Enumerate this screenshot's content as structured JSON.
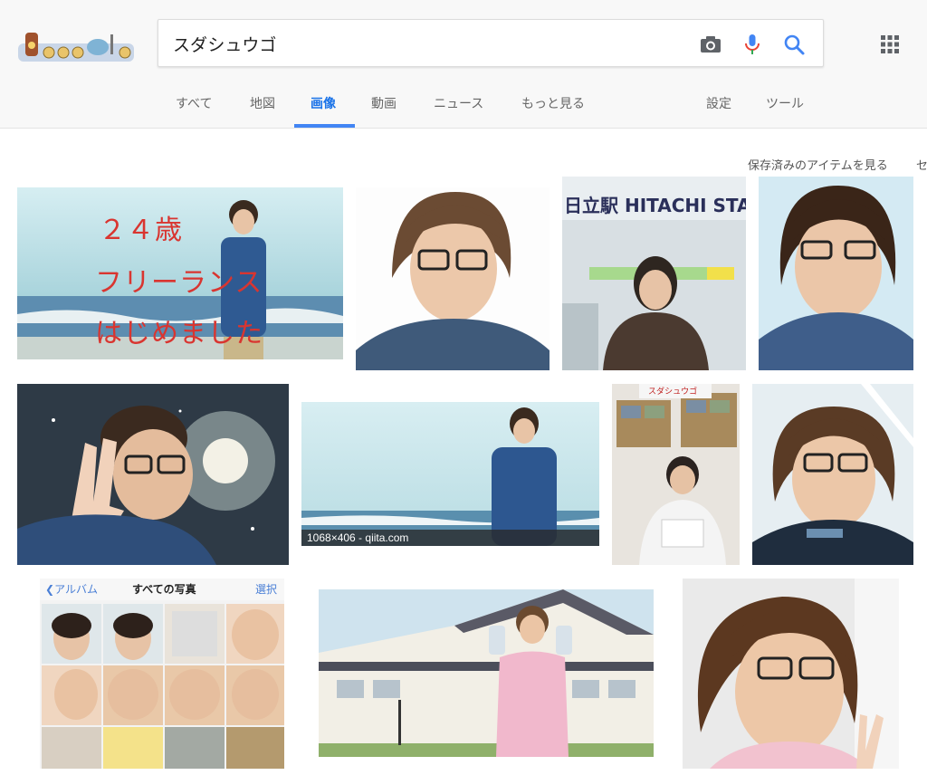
{
  "search": {
    "query": "スダシュウゴ"
  },
  "icons": {
    "camera": "camera-icon",
    "mic": "microphone-icon",
    "search": "search-icon",
    "apps": "apps-grid-icon"
  },
  "tabs": [
    {
      "label": "すべて"
    },
    {
      "label": "地図"
    },
    {
      "label": "画像",
      "active": true
    },
    {
      "label": "動画"
    },
    {
      "label": "ニュース"
    },
    {
      "label": "もっと見る"
    }
  ],
  "tools": {
    "settings": "設定",
    "tools": "ツール"
  },
  "saved_link": "保存済みのアイテムを見る",
  "saved_cut": "セ",
  "results": [
    {
      "overlay": [
        "２４歳",
        "フリーランス",
        "はじめました"
      ]
    },
    {},
    {
      "sign": "日立駅 HITACHI STA"
    },
    {},
    {},
    {
      "dim_label": "1068×406 - qiita.com"
    },
    {
      "sign": "スダシュウゴ"
    },
    {},
    {
      "back": "アルバム",
      "title": "すべての写真",
      "select": "選択"
    },
    {},
    {}
  ],
  "colors": {
    "accent": "#4285f4",
    "overlay_text": "#d93530"
  }
}
